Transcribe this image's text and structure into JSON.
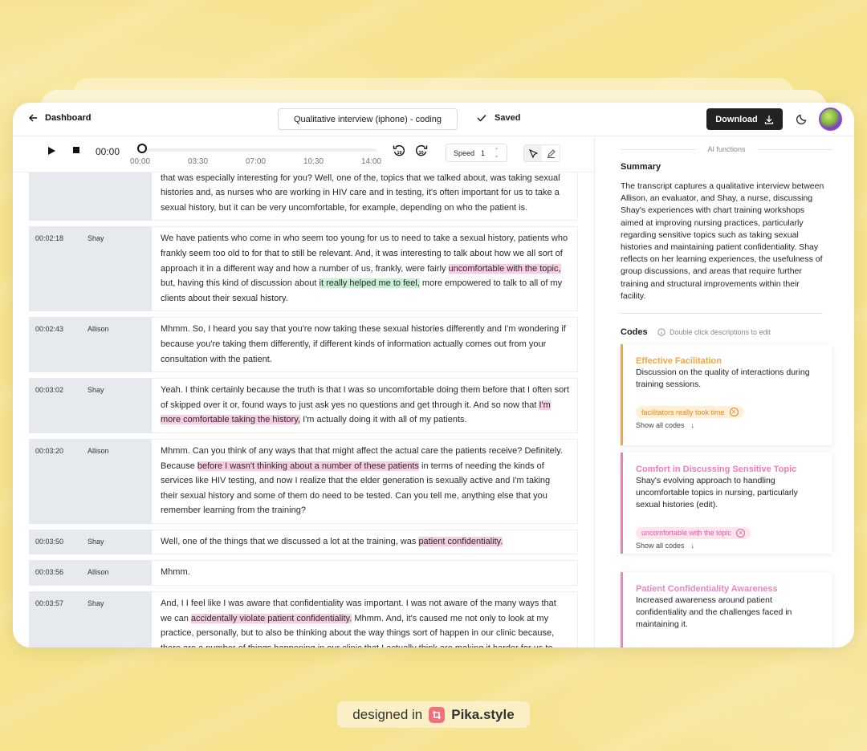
{
  "header": {
    "back_label": "Dashboard",
    "doc_title": "Qualitative interview (iphone) - coding",
    "saved_label": "Saved",
    "download_label": "Download"
  },
  "player": {
    "current_time": "00:00",
    "ticks": [
      "00:00",
      "03:30",
      "07:00",
      "10:30",
      "14:00"
    ],
    "speed_label": "Speed",
    "speed_value": "1"
  },
  "transcript": [
    {
      "ts": "",
      "speaker": "",
      "segments": [
        {
          "t": "having with the facilitators and with some of your colleagues, can you remember, any particular topic that was especially interesting for you? Well, one of the, topics that we talked about, was taking sexual histories and, as nurses who are working in HIV care and in testing, it's often important for us to take a sexual history, but it can be very uncomfortable, for example, depending on who the patient is.",
          "h": ""
        }
      ]
    },
    {
      "ts": "00:02:18",
      "speaker": "Shay",
      "segments": [
        {
          "t": "We have patients who come in who seem too young for us to need to take a sexual history, patients who frankly seem too old to for that to still be relevant. And, it was interesting to talk about how we all sort of approach it in a different way and how a number of us, frankly, were fairly ",
          "h": ""
        },
        {
          "t": "uncomfortable with the topic,",
          "h": "pink"
        },
        {
          "t": " but, having this kind of discussion about ",
          "h": ""
        },
        {
          "t": "it really helped me to feel,",
          "h": "green"
        },
        {
          "t": " more empowered to talk to all of my clients about their sexual history.",
          "h": ""
        }
      ]
    },
    {
      "ts": "00:02:43",
      "speaker": "Allison",
      "segments": [
        {
          "t": "Mhmm. So, I heard you say that you're now taking these sexual histories differently and I'm wondering if because you're taking them differently, if different kinds of information actually comes out from your consultation with the patient.",
          "h": ""
        }
      ]
    },
    {
      "ts": "00:03:02",
      "speaker": "Shay",
      "segments": [
        {
          "t": "Yeah. I think certainly because the truth is that I was so uncomfortable doing them before that I often sort of skipped over it or, found ways to just ask yes no questions and get through it. And so now that ",
          "h": ""
        },
        {
          "t": "I'm more comfortable taking the history,",
          "h": "pink"
        },
        {
          "t": " I'm actually doing it with all of my patients.",
          "h": ""
        }
      ]
    },
    {
      "ts": "00:03:20",
      "speaker": "Allison",
      "segments": [
        {
          "t": "Mhmm. Can you think of any ways that that might affect the actual care the patients receive? Definitely. Because ",
          "h": ""
        },
        {
          "t": "before I wasn't thinking about a number of these patients",
          "h": "pink"
        },
        {
          "t": " in terms of needing the kinds of services like HIV testing, and now I realize that the elder generation is sexually active and I'm taking their sexual history and some of them do need to be tested. Can you tell me, anything else that you remember learning from the training?",
          "h": ""
        }
      ]
    },
    {
      "ts": "00:03:50",
      "speaker": "Shay",
      "segments": [
        {
          "t": "Well, one of the things that we discussed a lot at the training, was ",
          "h": ""
        },
        {
          "t": "patient confidentiality.",
          "h": "pink"
        }
      ]
    },
    {
      "ts": "00:03:56",
      "speaker": "Allison",
      "segments": [
        {
          "t": "Mhmm.",
          "h": ""
        }
      ]
    },
    {
      "ts": "00:03:57",
      "speaker": "Shay",
      "segments": [
        {
          "t": "And, I I feel like I was aware that confidentiality was important. I was not aware of the many ways that we can ",
          "h": ""
        },
        {
          "t": "accidentally violate patient confidentiality.",
          "h": "pink"
        },
        {
          "t": " Mhmm. And, it's caused me not only to look at my practice, personally, but to also be thinking about the way things sort of happen in our clinic because, there are a number of things happening in our clinic that I actually think are making it harder for us to maintain patient",
          "h": ""
        }
      ]
    }
  ],
  "sidebar": {
    "ai_label": "AI functions",
    "summary_title": "Summary",
    "summary_text": "The transcript captures a qualitative interview between Allison, an evaluator, and Shay, a nurse, discussing Shay's experiences with chart training workshops aimed at improving nursing practices, particularly regarding sensitive topics such as taking sexual histories and maintaining patient confidentiality. Shay reflects on her learning experiences, the usefulness of group discussions, and areas that require further training and structural improvements within their facility.",
    "codes_title": "Codes",
    "codes_hint": "Double click descriptions to edit",
    "show_all_label": "Show all codes",
    "codes": [
      {
        "title": "Effective Facilitation",
        "desc": "Discussion on the quality of interactions during training sessions.",
        "chip": "facilitators really took time",
        "color": "#f5a53a",
        "chip_bg": "#fdf0da",
        "chip_fg": "#d98a2a"
      },
      {
        "title": "Comfort in Discussing Sensitive Topic",
        "desc": "Shay's evolving approach to handling uncomfortable topics in nursing, particularly sexual histories (edit).",
        "chip": "uncomfortable with the topic",
        "color": "#f27bb0",
        "chip_bg": "#fde4ef",
        "chip_fg": "#e0609a"
      },
      {
        "title": "Patient Confidentiality Awareness",
        "desc": "Increased awareness around patient confidentiality and the challenges faced in maintaining it.",
        "chip": "",
        "color": "#ee83c0",
        "chip_bg": "",
        "chip_fg": ""
      }
    ]
  },
  "footer": {
    "designed_in": "designed in",
    "brand": "Pika.style"
  }
}
